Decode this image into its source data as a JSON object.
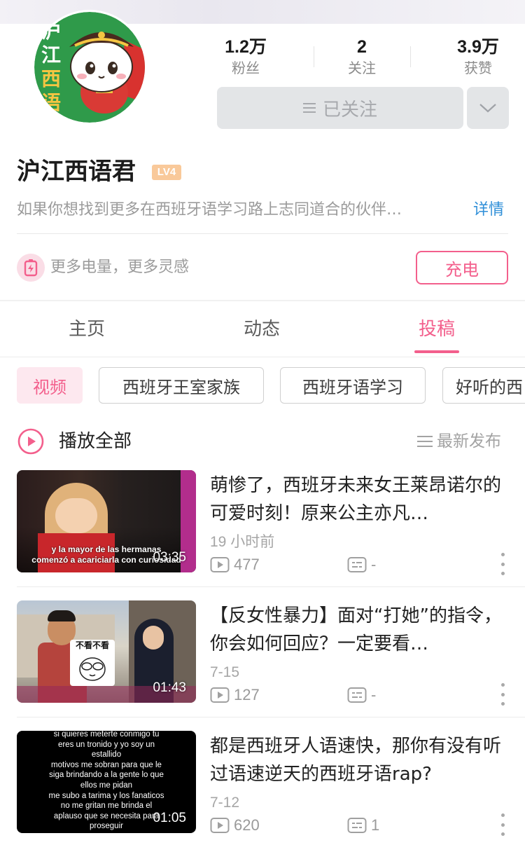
{
  "profile": {
    "avatar_icon": "cartoon-cat-pirate-avatar",
    "avatar_text": [
      "沪",
      "江",
      "西",
      "语"
    ],
    "name": "沪江西语君",
    "level": "LV4",
    "bio": "如果你想找到更多在西班牙语学习路上志同道合的伙伴…",
    "details_label": "详情"
  },
  "stats": [
    {
      "value": "1.2万",
      "label": "粉丝"
    },
    {
      "value": "2",
      "label": "关注"
    },
    {
      "value": "3.9万",
      "label": "获赞"
    }
  ],
  "follow": {
    "label": "已关注"
  },
  "charge": {
    "text": "更多电量，更多灵感",
    "button_label": "充电",
    "accent": "#f35f8c"
  },
  "tabs": [
    {
      "label": "主页",
      "active": false
    },
    {
      "label": "动态",
      "active": false
    },
    {
      "label": "投稿",
      "active": true
    }
  ],
  "filters": [
    {
      "label": "视频",
      "selected": true
    },
    {
      "label": "西班牙王室家族",
      "selected": false
    },
    {
      "label": "西班牙语学习",
      "selected": false
    },
    {
      "label": "好听的西",
      "selected": false
    }
  ],
  "list_header": {
    "play_all": "播放全部",
    "sort": "最新发布"
  },
  "videos": [
    {
      "title": "萌惨了，西班牙未来女王莱昂诺尔的可爱时刻！原来公主亦凡…",
      "date": "19 小时前",
      "views": "477",
      "comments": "-",
      "duration": "03:35",
      "thumb_caption": [
        "y la mayor de las hermanas",
        "comenzó a acariciarla con curiosidad"
      ]
    },
    {
      "title": "【反女性暴力】面对“打她”的指令，你会如何回应？一定要看…",
      "date": "7-15",
      "views": "127",
      "comments": "-",
      "duration": "01:43",
      "thumb_caption": [
        "不看不看"
      ]
    },
    {
      "title": "都是西班牙人语速快，那你有没有听过语速逆天的西班牙语rap?",
      "date": "7-12",
      "views": "620",
      "comments": "1",
      "duration": "01:05",
      "thumb_caption": [
        "si quieres meterte conmigo tu",
        "eres un tronido y yo soy un",
        "estallido",
        "motivos me sobran para que le",
        "siga brindando a la gente lo que",
        "ellos me pidan",
        "me subo a tarima y los fanaticos",
        "no me gritan me brinda el",
        "aplauso que se necesita para",
        "proseguir"
      ]
    }
  ]
}
